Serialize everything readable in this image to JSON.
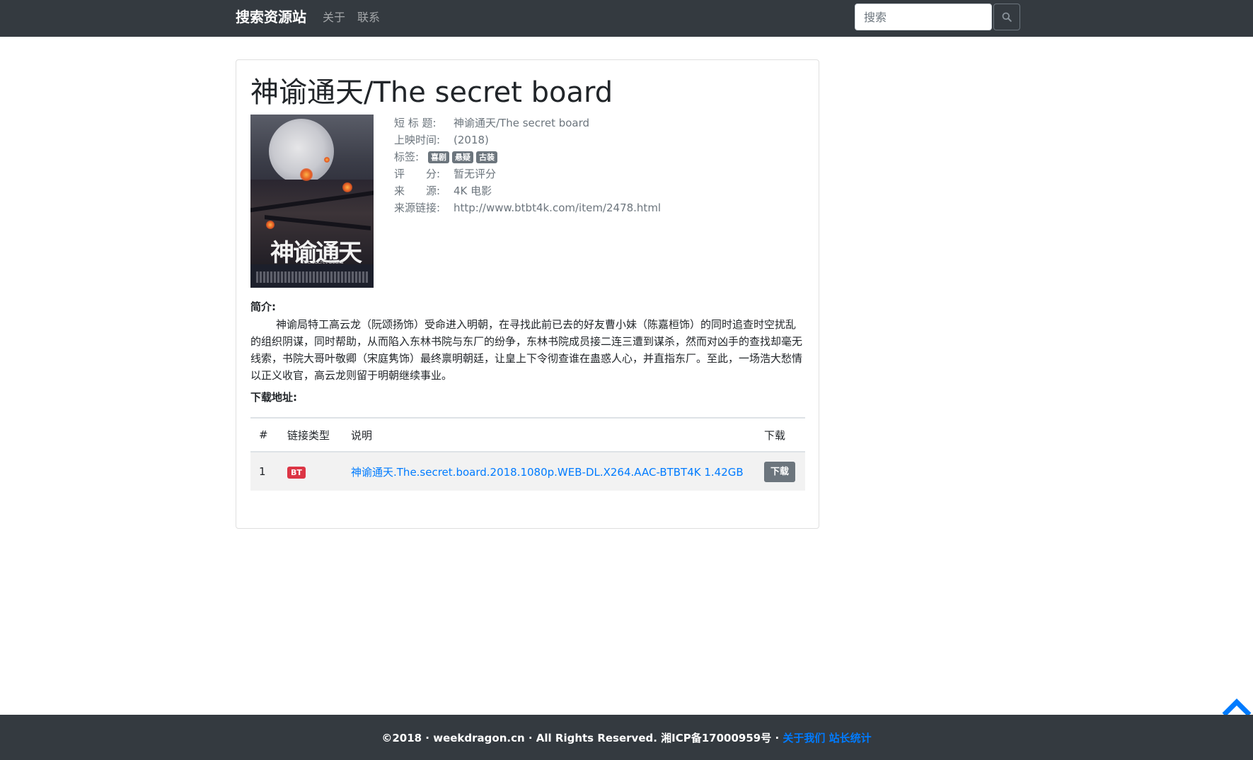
{
  "navbar": {
    "brand": "搜索资源站",
    "links": [
      "关于",
      "联系"
    ],
    "search_placeholder": "搜索",
    "search_icon": "search-icon"
  },
  "movie": {
    "title": "神谕通天/The secret board",
    "poster": {
      "calligraphy": "神谕通天",
      "subtitle": "The secret board"
    },
    "info": {
      "short_title_label": "短 标 题:",
      "short_title": "神谕通天/The secret board",
      "release_label": "上映时间:",
      "release": "(2018)",
      "tags_label": "标签:",
      "tags": [
        "喜剧",
        "悬疑",
        "古装"
      ],
      "rating_label": "评　　分:",
      "rating": "暂无评分",
      "source_label": "来　　源:",
      "source": "4K 电影",
      "source_link_label": "来源链接:",
      "source_link": "http://www.btbt4k.com/item/2478.html"
    },
    "intro_label": "简介:",
    "intro": "神谕局特工高云龙（阮颂扬饰）受命进入明朝，在寻找此前已去的好友曹小妹（陈嘉桓饰）的同时追查时空扰乱的组织阴谋，同时帮助，从而陷入东林书院与东厂的纷争，东林书院成员接二连三遭到谋杀，然而对凶手的查找却毫无线索，书院大哥叶敬卿（宋庭隽饰）最终禀明朝廷，让皇上下令彻查谁在蛊惑人心，并直指东厂。至此，一场浩大愁情以正义收官，高云龙则留于明朝继续事业。",
    "download_label": "下载地址:"
  },
  "downloads": {
    "headers": [
      "#",
      "链接类型",
      "说明",
      "下载"
    ],
    "rows": [
      {
        "index": "1",
        "type": "BT",
        "description": "神谕通天.The.secret.board.2018.1080p.WEB-DL.X264.AAC-BTBT4K 1.42GB",
        "button": "下载"
      }
    ]
  },
  "footer": {
    "text": "©2018 · weekdragon.cn · All Rights Reserved.  湘ICP备17000959号 · ",
    "links": [
      "关于我们",
      "站长统计"
    ]
  },
  "colors": {
    "navbar_bg": "#343a40",
    "link": "#007bff",
    "badge_danger": "#dc3545",
    "badge_secondary": "#6c757d"
  },
  "icons": {
    "back_to_top": "chevron-up-icon"
  }
}
